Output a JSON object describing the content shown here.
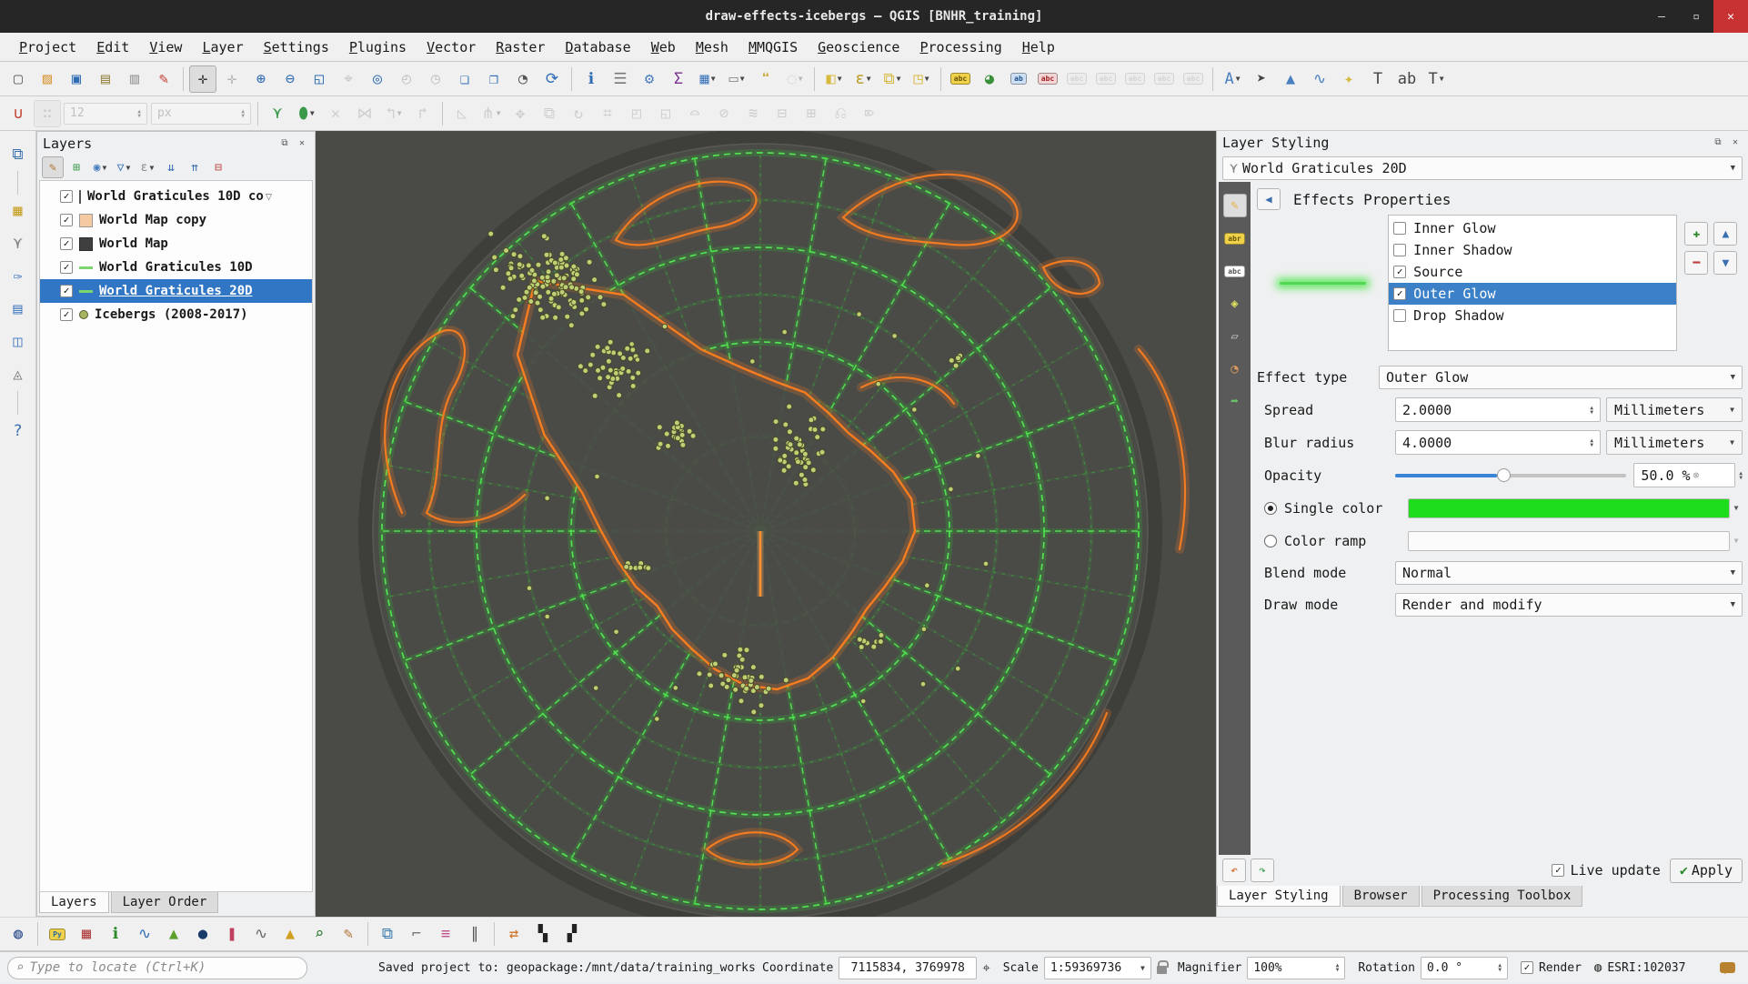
{
  "window": {
    "title": "draw-effects-icebergs — QGIS [BNHR_training]",
    "minimize": "–",
    "maximize": "▫",
    "close": "✕"
  },
  "menubar": {
    "items": [
      "Project",
      "Edit",
      "View",
      "Layer",
      "Settings",
      "Plugins",
      "Vector",
      "Raster",
      "Database",
      "Web",
      "Mesh",
      "MMQGIS",
      "Geoscience",
      "Processing",
      "Help"
    ]
  },
  "toolbars": {
    "main": [
      {
        "n": "project-new",
        "g": "▢",
        "c": "#666"
      },
      {
        "n": "project-open",
        "g": "▨",
        "c": "#d99b3d"
      },
      {
        "n": "project-save",
        "g": "▣",
        "c": "#2e6db4"
      },
      {
        "n": "new-print-layout",
        "g": "▤",
        "c": "#9a8a4a"
      },
      {
        "n": "layout-manager",
        "g": "▥",
        "c": "#999"
      },
      {
        "n": "style-manager",
        "g": "✎",
        "c": "#c0392b"
      },
      {
        "n": "pan-map",
        "g": "✛",
        "c": "#333",
        "sep": true,
        "pressed": true
      },
      {
        "n": "pan-to-selection",
        "g": "✛",
        "c": "#333",
        "dis": true
      },
      {
        "n": "zoom-in",
        "g": "⊕",
        "c": "#2e6db4"
      },
      {
        "n": "zoom-out",
        "g": "⊖",
        "c": "#2e6db4"
      },
      {
        "n": "zoom-full",
        "g": "◱",
        "c": "#2e6db4"
      },
      {
        "n": "zoom-to-selection",
        "g": "⌖",
        "c": "#2e6db4",
        "dis": true
      },
      {
        "n": "zoom-to-layer",
        "g": "◎",
        "c": "#2e6db4"
      },
      {
        "n": "zoom-last",
        "g": "◴",
        "c": "#2e6db4",
        "dis": true
      },
      {
        "n": "zoom-next",
        "g": "◷",
        "c": "#2e6db4",
        "dis": true
      },
      {
        "n": "new-spatial-bookmark",
        "g": "❏",
        "c": "#2e6db4"
      },
      {
        "n": "show-bookmarks",
        "g": "❐",
        "c": "#2e6db4"
      },
      {
        "n": "temporal-controller",
        "g": "◔",
        "c": "#555"
      },
      {
        "n": "refresh-map",
        "g": "⟳",
        "c": "#2e6db4"
      },
      {
        "n": "identify-features",
        "g": "ℹ",
        "c": "#2e6db4",
        "sep": true
      },
      {
        "n": "statistical-summary",
        "g": "☰",
        "c": "#777"
      },
      {
        "n": "processing-options",
        "g": "⚙",
        "c": "#4a7fc0"
      },
      {
        "n": "show-sum",
        "g": "Σ",
        "c": "#7b2f8e"
      },
      {
        "n": "attribute-table",
        "g": "▦",
        "c": "#4a7fc0",
        "caret": true
      },
      {
        "n": "measure",
        "g": "▭",
        "c": "#888",
        "caret": true
      },
      {
        "n": "map-tips",
        "g": "❝",
        "c": "#c9a93a"
      },
      {
        "n": "zoom-extra",
        "g": "◌",
        "c": "#999",
        "dis": true,
        "caret": true
      },
      {
        "n": "select-features",
        "g": "◧",
        "c": "#d7b93c",
        "sep": true,
        "caret": true
      },
      {
        "n": "select-by-expression",
        "g": "ε",
        "c": "#b89a20",
        "caret": true
      },
      {
        "n": "deselect-features",
        "g": "⧉",
        "c": "#d7b93c",
        "caret": true
      },
      {
        "n": "invert-selection",
        "g": "◳",
        "c": "#d7b93c",
        "caret": true
      },
      {
        "n": "layer-labeling",
        "chip": "abc",
        "cc": "#6a5200",
        "cb": "#f0d24a",
        "sep": true
      },
      {
        "n": "layer-diagram",
        "g": "◕",
        "c": "#3a8f3a"
      },
      {
        "n": "pin-labels",
        "chip": "ab",
        "cc": "#1a4f8a",
        "cb": "#cfe0f4"
      },
      {
        "n": "highlight-labels",
        "chip": "abc",
        "cc": "#a02020",
        "cb": "#f4d4d4"
      },
      {
        "n": "move-label",
        "chip": "abc",
        "cc": "#999",
        "cb": "#e6e6e6",
        "dis": true
      },
      {
        "n": "show-hide-labels",
        "chip": "abc",
        "cc": "#999",
        "cb": "#e6e6e6",
        "dis": true
      },
      {
        "n": "move-label-diagram",
        "chip": "abc",
        "cc": "#999",
        "cb": "#e6e6e6",
        "dis": true
      },
      {
        "n": "rotate-label",
        "chip": "abc",
        "cc": "#999",
        "cb": "#e6e6e6",
        "dis": true
      },
      {
        "n": "change-label",
        "chip": "abc",
        "cc": "#999",
        "cb": "#e6e6e6",
        "dis": true
      },
      {
        "n": "new-annotation",
        "g": "A",
        "c": "#4a7fc0",
        "sep": true,
        "caret": true
      },
      {
        "n": "select-annotation",
        "g": "➤",
        "c": "#444"
      },
      {
        "n": "polygon-annotation",
        "g": "▲",
        "c": "#4a7fc0"
      },
      {
        "n": "line-annotation",
        "g": "∿",
        "c": "#4a7fc0"
      },
      {
        "n": "marker-annotation",
        "g": "✦",
        "c": "#d7b93c"
      },
      {
        "n": "text-annotation",
        "g": "T",
        "c": "#444"
      },
      {
        "n": "html-annotation",
        "g": "ab",
        "c": "#444"
      },
      {
        "n": "bubble-annotation",
        "g": "T",
        "c": "#444",
        "caret": true
      }
    ],
    "digitizing": [
      {
        "n": "snapping-toggle",
        "g": "∪",
        "c": "#c0392b"
      },
      {
        "n": "advanced-digitizing-dock",
        "g": "∷",
        "c": "#777",
        "dis": true,
        "pressed": true
      },
      {
        "n": "snap-tolerance",
        "type": "spin",
        "v": "12",
        "dis": true
      },
      {
        "n": "snap-unit",
        "type": "combo",
        "v": "px",
        "dis": true
      },
      {
        "n": "tracing",
        "g": "⋎",
        "c": "#3a9a4a",
        "sep": true
      },
      {
        "n": "digitize-shape",
        "g": "⬮",
        "c": "#3a9a4a",
        "caret": true
      },
      {
        "n": "cancel-edits",
        "g": "✕",
        "c": "#888",
        "dis": true
      },
      {
        "n": "rollback-edits",
        "g": "⋈",
        "c": "#888",
        "dis": true
      },
      {
        "n": "save-edits",
        "g": "↰",
        "c": "#888",
        "dis": true,
        "caret": true
      },
      {
        "n": "redo-edits",
        "g": "↱",
        "c": "#888",
        "dis": true
      },
      {
        "n": "cad-tools",
        "g": "◺",
        "c": "#888",
        "sep": true,
        "dis": true
      },
      {
        "n": "vertex-tool",
        "g": "⋔",
        "c": "#888",
        "dis": true,
        "caret": true
      },
      {
        "n": "move-feature",
        "g": "✥",
        "c": "#888",
        "dis": true
      },
      {
        "n": "copy-move-feature",
        "g": "⧉",
        "c": "#888",
        "dis": true
      },
      {
        "n": "rotate-feature",
        "g": "↻",
        "c": "#888",
        "dis": true
      },
      {
        "n": "simplify-feature",
        "g": "⌗",
        "c": "#888",
        "dis": true
      },
      {
        "n": "add-ring",
        "g": "◰",
        "c": "#888",
        "dis": true
      },
      {
        "n": "add-part",
        "g": "◱",
        "c": "#888",
        "dis": true
      },
      {
        "n": "fill-ring",
        "g": "⌓",
        "c": "#888",
        "dis": true
      },
      {
        "n": "delete-ring",
        "g": "⊘",
        "c": "#888",
        "dis": true
      },
      {
        "n": "offset-curve",
        "g": "≋",
        "c": "#888",
        "dis": true
      },
      {
        "n": "split-features",
        "g": "⊟",
        "c": "#888",
        "dis": true
      },
      {
        "n": "merge-features",
        "g": "⊞",
        "c": "#888",
        "dis": true
      },
      {
        "n": "reshape-features",
        "g": "⎌",
        "c": "#888",
        "dis": true
      },
      {
        "n": "trim-extend",
        "g": "⌦",
        "c": "#888",
        "dis": true
      }
    ],
    "plugins": [
      {
        "n": "osm-place-search",
        "g": "◍",
        "c": "#2a4a8a"
      },
      {
        "n": "python-console",
        "chip": "Py",
        "cc": "#2a6aa0",
        "cb": "#f0d24a",
        "sep": true
      },
      {
        "n": "attribute-grid",
        "g": "▦",
        "c": "#b04040"
      },
      {
        "n": "feature-info",
        "g": "ℹ",
        "c": "#2a8a2a"
      },
      {
        "n": "profile-plot",
        "g": "∿",
        "c": "#2e6db4"
      },
      {
        "n": "area-analysis",
        "g": "▲",
        "c": "#5aa02a"
      },
      {
        "n": "globe-view",
        "g": "●",
        "c": "#1a3a6a"
      },
      {
        "n": "color-bars",
        "g": "❚",
        "c": "#c04060"
      },
      {
        "n": "histogram-tool",
        "g": "∿",
        "c": "#666"
      },
      {
        "n": "surface-plot",
        "g": "▲",
        "c": "#d0a020"
      },
      {
        "n": "zoom-tool-plugin",
        "g": "⌕",
        "c": "#2a7a2a"
      },
      {
        "n": "map-annotate",
        "g": "✎",
        "c": "#b07030"
      },
      {
        "n": "copy-canvas",
        "g": "⧉",
        "c": "#3a7ab0",
        "sep": true
      },
      {
        "n": "profile-line",
        "g": "⌐",
        "c": "#777"
      },
      {
        "n": "colored-lines",
        "g": "≡",
        "c": "#c05090"
      },
      {
        "n": "hatching-tool",
        "g": "∥",
        "c": "#555"
      },
      {
        "n": "layer-swap",
        "g": "⇄",
        "c": "#d07020",
        "sep": true
      },
      {
        "n": "bw-map-left",
        "g": "▚",
        "c": "#222"
      },
      {
        "n": "bw-map-right",
        "g": "▞",
        "c": "#222"
      }
    ],
    "left": [
      {
        "n": "data-source-manager",
        "g": "⧉",
        "c": "#3a6fb0"
      },
      {
        "n": "new-geopackage",
        "g": "▦",
        "c": "#c8a22a",
        "sep": true
      },
      {
        "n": "new-shapefile-layer",
        "g": "⋎",
        "c": "#888"
      },
      {
        "n": "new-spatialite-layer",
        "g": "✑",
        "c": "#4a7fc0"
      },
      {
        "n": "new-temporary-scratch-layer",
        "g": "▤",
        "c": "#4a7fc0"
      },
      {
        "n": "new-mesh-layer",
        "g": "◫",
        "c": "#4a7fc0"
      },
      {
        "n": "new-gpx-layer",
        "g": "◬",
        "c": "#7a7a7a"
      },
      {
        "n": "help",
        "g": "?",
        "c": "#3a6fb0",
        "sep": true
      }
    ],
    "styling_tabs": [
      {
        "n": "symbology-tab",
        "g": "✎",
        "c": "#e8b24a",
        "active": true
      },
      {
        "n": "labels-tab",
        "chip": "abr",
        "cc": "#6a5200",
        "cb": "#f0d24a"
      },
      {
        "n": "mask-tab",
        "chip": "abc",
        "cc": "#555",
        "cb": "#ffffff"
      },
      {
        "n": "view-3d-tab",
        "g": "◈",
        "c": "#e0e060"
      },
      {
        "n": "transparency-tab",
        "g": "▱",
        "c": "#cccccc"
      },
      {
        "n": "history-tab",
        "g": "◔",
        "c": "#e09a5a"
      },
      {
        "n": "attributes-tab",
        "g": "➦",
        "c": "#6ac06a"
      }
    ],
    "layers_tb": [
      {
        "n": "open-layer-styling",
        "g": "✎",
        "c": "#b0702a",
        "pressed": true
      },
      {
        "n": "add-group",
        "g": "⊞",
        "c": "#3a9a4a"
      },
      {
        "n": "manage-map-themes",
        "g": "◉",
        "c": "#4a7fc0",
        "caret": true
      },
      {
        "n": "filter-legend",
        "g": "▽",
        "c": "#2e6db4",
        "caret": true
      },
      {
        "n": "filter-by-expression",
        "g": "ε",
        "c": "#888",
        "caret": true
      },
      {
        "n": "expand-all",
        "g": "⇊",
        "c": "#3a6fb0"
      },
      {
        "n": "collapse-all",
        "g": "⇈",
        "c": "#3a6fb0"
      },
      {
        "n": "remove-layer",
        "g": "⊟",
        "c": "#c04040"
      }
    ]
  },
  "layers_panel": {
    "title": "Layers",
    "items": [
      {
        "label": "World Graticules 10D co",
        "checked": true,
        "symbol": "line-dark",
        "selected": false,
        "filter": true
      },
      {
        "label": "World Map copy",
        "checked": true,
        "symbol": "fill-peach",
        "selected": false
      },
      {
        "label": "World Map",
        "checked": true,
        "symbol": "fill-darkgray",
        "selected": false
      },
      {
        "label": "World Graticules 10D",
        "checked": true,
        "symbol": "line-green",
        "selected": false
      },
      {
        "label": "World Graticules 20D",
        "checked": true,
        "symbol": "line-green",
        "selected": true
      },
      {
        "label": "Icebergs (2008-2017)",
        "checked": true,
        "symbol": "point-olive",
        "selected": false
      }
    ],
    "bottom_tabs": [
      {
        "label": "Layers",
        "active": true
      },
      {
        "label": "Layer Order",
        "active": false
      }
    ]
  },
  "styling_panel": {
    "title": "Layer Styling",
    "layer_combo_value": "World Graticules 20D",
    "section_title": "Effects Properties",
    "effects": [
      {
        "label": "Inner Glow",
        "checked": false,
        "selected": false
      },
      {
        "label": "Inner Shadow",
        "checked": false,
        "selected": false
      },
      {
        "label": "Source",
        "checked": true,
        "selected": false
      },
      {
        "label": "Outer Glow",
        "checked": true,
        "selected": true
      },
      {
        "label": "Drop Shadow",
        "checked": false,
        "selected": false
      }
    ],
    "effect_type_label": "Effect type",
    "effect_type_value": "Outer Glow",
    "spread_label": "Spread",
    "spread_value": "2.0000",
    "spread_unit": "Millimeters",
    "blur_label": "Blur radius",
    "blur_value": "4.0000",
    "blur_unit": "Millimeters",
    "opacity_label": "Opacity",
    "opacity_value": "50.0 %",
    "single_color_label": "Single color",
    "single_color": "#1ddd1d",
    "color_ramp_label": "Color ramp",
    "blend_label": "Blend mode",
    "blend_value": "Normal",
    "draw_label": "Draw mode",
    "draw_value": "Render and modify",
    "live_update_label": "Live update",
    "apply_label": "Apply",
    "bottom_tabs": [
      {
        "label": "Layer Styling",
        "active": true
      },
      {
        "label": "Browser",
        "active": false
      },
      {
        "label": "Processing Toolbox",
        "active": false
      }
    ]
  },
  "status_bar": {
    "locate_placeholder": "Type to locate (Ctrl+K)",
    "message": "Saved project to: geopackage:/mnt/data/training_works",
    "coordinate_label": "Coordinate",
    "coordinate_value": "7115834, 3769978",
    "scale_label": "Scale",
    "scale_value": "1:59369736",
    "magnifier_label": "Magnifier",
    "magnifier_value": "100%",
    "rotation_label": "Rotation",
    "rotation_value": "0.0 °",
    "render_label": "Render",
    "crs_label": "ESRI:102037"
  },
  "map": {
    "graticule_color": "#2fd42f",
    "coast_color": "#ff7f1f",
    "iceberg_color": "#bfcf74",
    "background": "#4a4a47"
  }
}
